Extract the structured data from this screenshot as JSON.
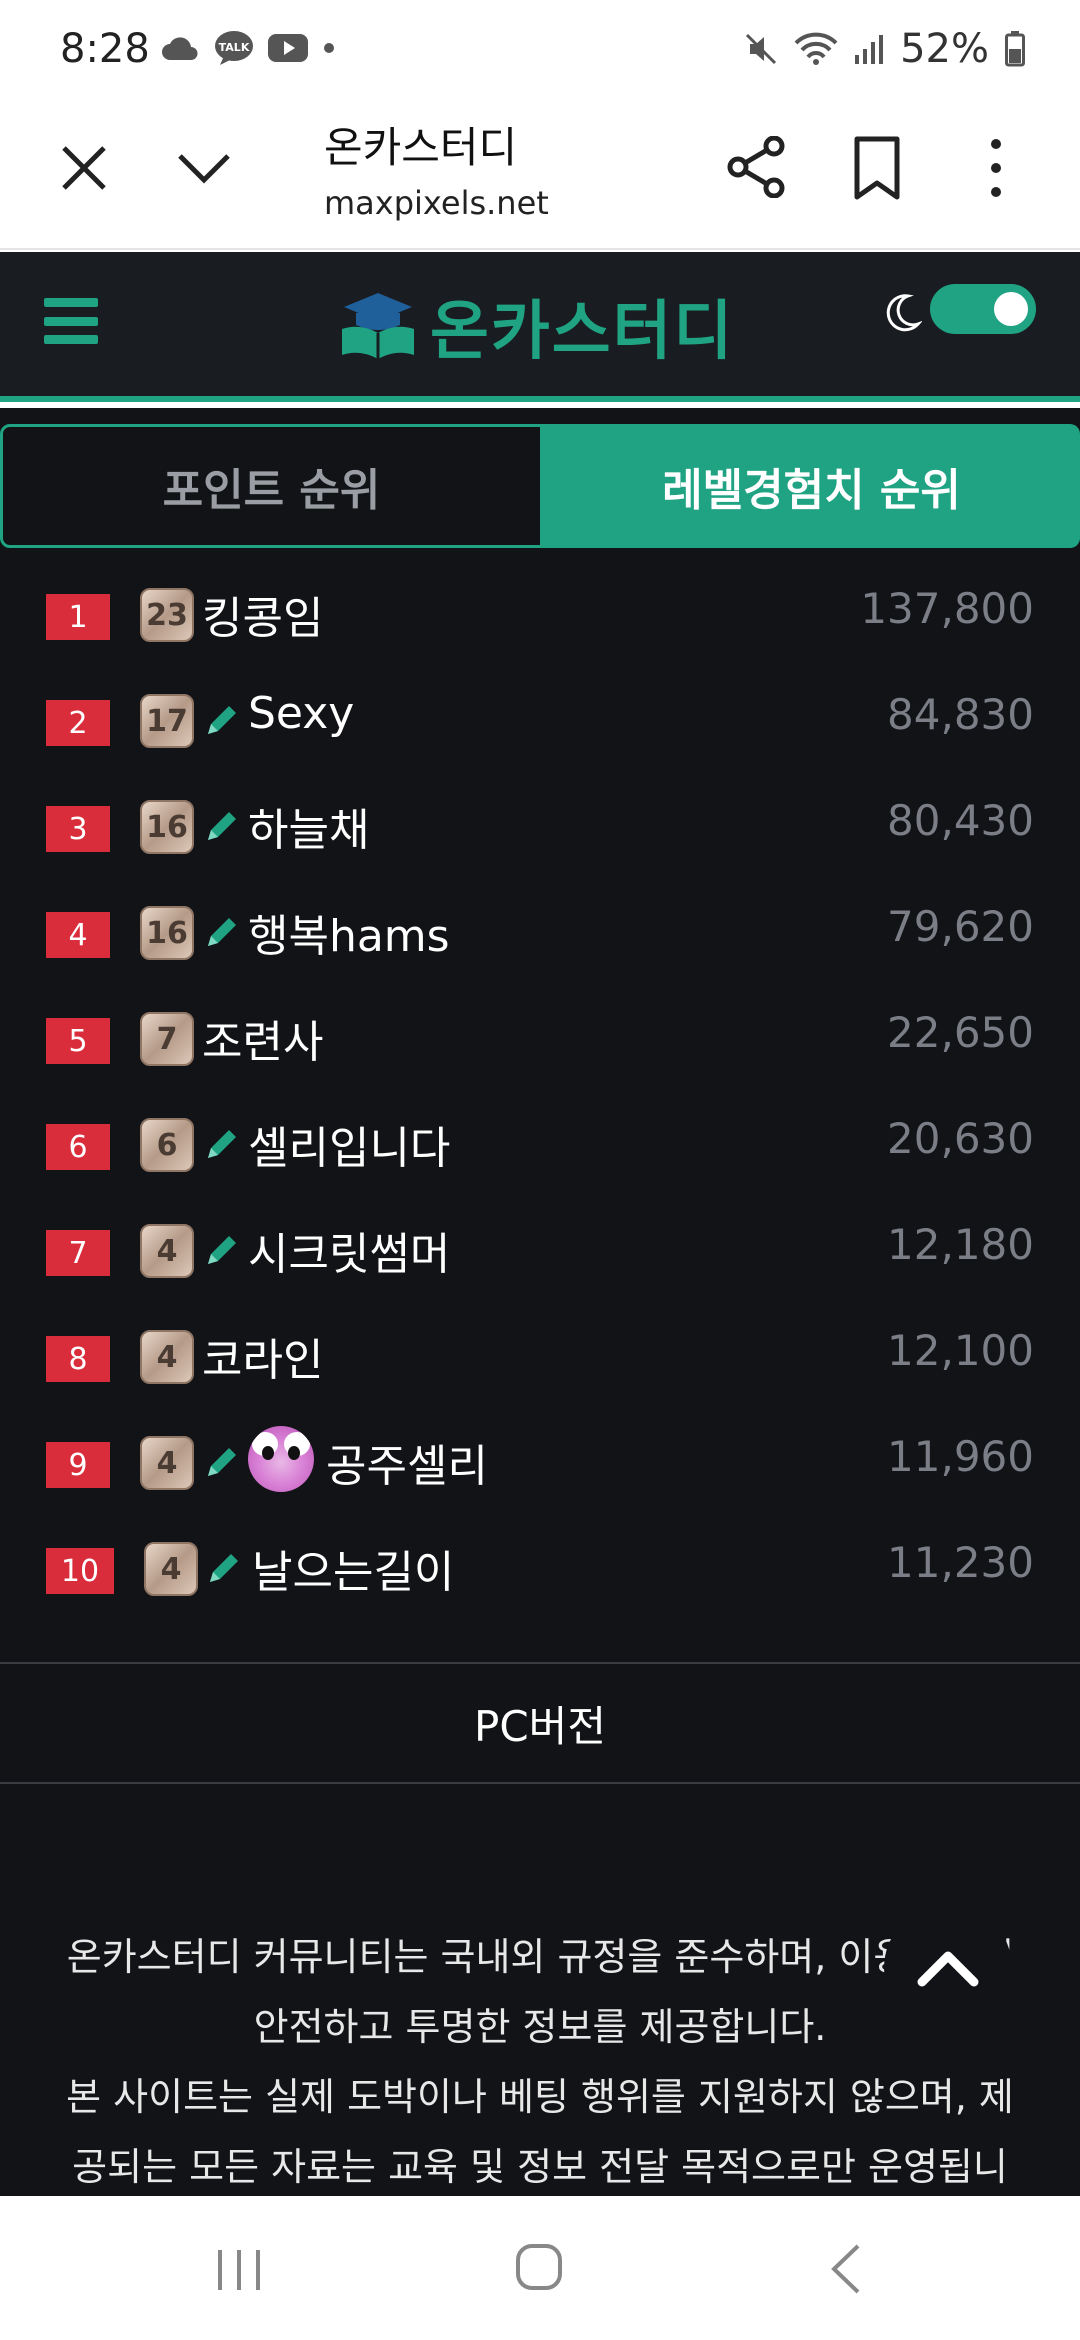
{
  "status_bar": {
    "time": "8:28",
    "battery": "52%",
    "left_icons": [
      "cloud-icon",
      "talk-icon",
      "youtube-icon",
      "dot-icon"
    ],
    "right_icons": [
      "mute-icon",
      "wifi-icon",
      "signal-icon",
      "battery-icon"
    ],
    "talk_label": "TALK"
  },
  "browser": {
    "title": "온카스터디",
    "url": "maxpixels.net"
  },
  "site": {
    "logo_text": "온카스터디",
    "accent": "#1fa383",
    "dark_mode_on": true
  },
  "tabs": [
    {
      "label": "포인트 순위",
      "active": false
    },
    {
      "label": "레벨경험치 순위",
      "active": true
    }
  ],
  "ranking": [
    {
      "rank": "1",
      "level": "23",
      "editor": false,
      "avatar": false,
      "nick": "킹콩임",
      "points": "137,800"
    },
    {
      "rank": "2",
      "level": "17",
      "editor": true,
      "avatar": false,
      "nick": "Sexy",
      "points": "84,830"
    },
    {
      "rank": "3",
      "level": "16",
      "editor": true,
      "avatar": false,
      "nick": "하늘채",
      "points": "80,430"
    },
    {
      "rank": "4",
      "level": "16",
      "editor": true,
      "avatar": false,
      "nick": "행복hams",
      "points": "79,620"
    },
    {
      "rank": "5",
      "level": "7",
      "editor": false,
      "avatar": false,
      "nick": "조련사",
      "points": "22,650"
    },
    {
      "rank": "6",
      "level": "6",
      "editor": true,
      "avatar": false,
      "nick": "셀리입니다",
      "points": "20,630"
    },
    {
      "rank": "7",
      "level": "4",
      "editor": true,
      "avatar": false,
      "nick": "시크릿썸머",
      "points": "12,180"
    },
    {
      "rank": "8",
      "level": "4",
      "editor": false,
      "avatar": false,
      "nick": "코라인",
      "points": "12,100"
    },
    {
      "rank": "9",
      "level": "4",
      "editor": true,
      "avatar": true,
      "nick": "공주셀리",
      "points": "11,960"
    },
    {
      "rank": "10",
      "level": "4",
      "editor": true,
      "avatar": false,
      "nick": "날으는길이",
      "points": "11,230"
    }
  ],
  "pc_version_label": "PC버전",
  "footer": {
    "lines": [
      "온카스터디 커뮤니티는 국내외 규정을 준수하며, 이용자에게",
      "안전하고 투명한 정보를 제공합니다.",
      "본 사이트는 실제 도박이나 베팅 행위를 지원하지 않으며, 제",
      "공되는 모든 자료는 교육 및 정보 전달 목적으로만 운영됩니"
    ]
  }
}
